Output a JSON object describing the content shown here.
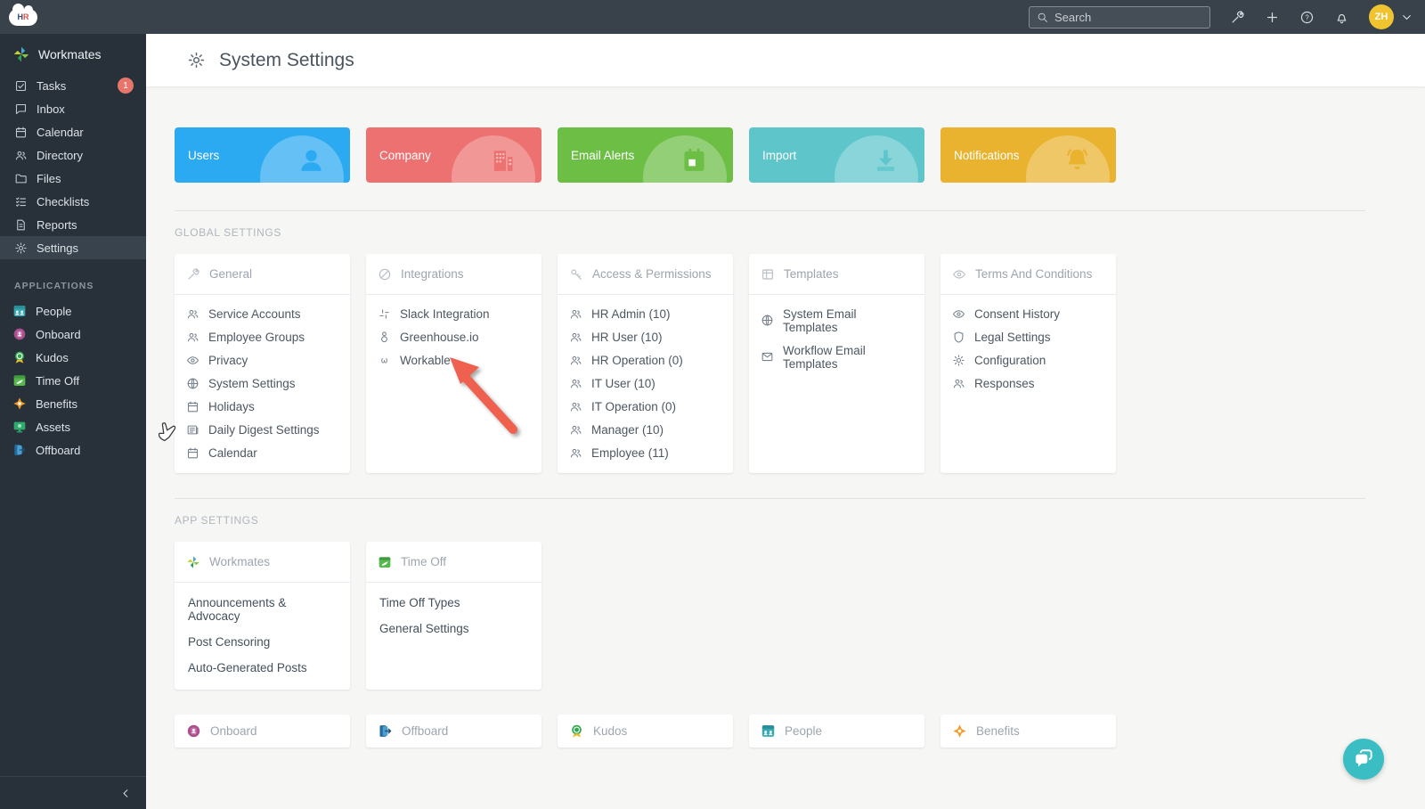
{
  "topbar": {
    "logo_h": "H",
    "logo_r": "R",
    "search_placeholder": "Search",
    "icons": [
      "wrench-icon",
      "plus-icon",
      "help-icon",
      "bell-icon"
    ],
    "avatar_initials": "ZH"
  },
  "sidebar": {
    "brand": "Workmates",
    "items": [
      {
        "label": "Tasks",
        "icon": "check-square-icon",
        "badge": "1"
      },
      {
        "label": "Inbox",
        "icon": "chat-icon"
      },
      {
        "label": "Calendar",
        "icon": "calendar-icon"
      },
      {
        "label": "Directory",
        "icon": "people-icon"
      },
      {
        "label": "Files",
        "icon": "folder-icon"
      },
      {
        "label": "Checklists",
        "icon": "checklist-icon"
      },
      {
        "label": "Reports",
        "icon": "document-icon"
      },
      {
        "label": "Settings",
        "icon": "gear-icon",
        "active": true
      }
    ],
    "applications_label": "APPLICATIONS",
    "applications": [
      {
        "label": "People",
        "icon": "app-people-icon"
      },
      {
        "label": "Onboard",
        "icon": "app-onboard-icon"
      },
      {
        "label": "Kudos",
        "icon": "app-kudos-icon"
      },
      {
        "label": "Time Off",
        "icon": "app-timeoff-icon"
      },
      {
        "label": "Benefits",
        "icon": "app-benefits-icon"
      },
      {
        "label": "Assets",
        "icon": "app-assets-icon"
      },
      {
        "label": "Offboard",
        "icon": "app-offboard-icon"
      }
    ]
  },
  "header": {
    "title": "System Settings",
    "icon": "gear-icon"
  },
  "cards": [
    {
      "label": "Users",
      "color": "#2BA9F1",
      "icon": "user-filled-icon"
    },
    {
      "label": "Company",
      "color": "#EC7170",
      "icon": "building-filled-icon"
    },
    {
      "label": "Email Alerts",
      "color": "#6CBE45",
      "icon": "calendar-filled-icon"
    },
    {
      "label": "Import",
      "color": "#5EC6CB",
      "icon": "download-filled-icon"
    },
    {
      "label": "Notifications",
      "color": "#E9B32F",
      "icon": "bell-filled-icon"
    }
  ],
  "global_settings": {
    "label": "GLOBAL SETTINGS",
    "columns": [
      {
        "title": "General",
        "icon": "wrench-icon",
        "items": [
          {
            "label": "Service Accounts",
            "icon": "people-icon"
          },
          {
            "label": "Employee Groups",
            "icon": "people-icon"
          },
          {
            "label": "Privacy",
            "icon": "eye-icon"
          },
          {
            "label": "System Settings",
            "icon": "globe-icon"
          },
          {
            "label": "Holidays",
            "icon": "calendar-icon"
          },
          {
            "label": "Daily Digest Settings",
            "icon": "newspaper-icon"
          },
          {
            "label": "Calendar",
            "icon": "calendar-icon"
          }
        ]
      },
      {
        "title": "Integrations",
        "icon": "link-icon",
        "items": [
          {
            "label": "Slack Integration",
            "icon": "slack-icon"
          },
          {
            "label": "Greenhouse.io",
            "icon": "greenhouse-icon"
          },
          {
            "label": "Workable",
            "icon": "workable-icon"
          }
        ]
      },
      {
        "title": "Access & Permissions",
        "icon": "key-icon",
        "items": [
          {
            "label": "HR Admin (10)",
            "icon": "people-icon"
          },
          {
            "label": "HR User (10)",
            "icon": "people-icon"
          },
          {
            "label": "HR Operation (0)",
            "icon": "people-icon"
          },
          {
            "label": "IT User (10)",
            "icon": "people-icon"
          },
          {
            "label": "IT Operation (0)",
            "icon": "people-icon"
          },
          {
            "label": "Manager (10)",
            "icon": "people-icon"
          },
          {
            "label": "Employee (11)",
            "icon": "people-icon"
          }
        ]
      },
      {
        "title": "Templates",
        "icon": "table-icon",
        "items": [
          {
            "label": "System Email Templates",
            "icon": "globe-icon"
          },
          {
            "label": "Workflow Email Templates",
            "icon": "envelope-icon"
          }
        ]
      },
      {
        "title": "Terms And Conditions",
        "icon": "eye-icon",
        "items": [
          {
            "label": "Consent History",
            "icon": "eye-icon"
          },
          {
            "label": "Legal Settings",
            "icon": "shield-icon"
          },
          {
            "label": "Configuration",
            "icon": "gear-icon"
          },
          {
            "label": "Responses",
            "icon": "people-icon"
          }
        ]
      }
    ]
  },
  "app_settings": {
    "label": "APP SETTINGS",
    "cards": [
      {
        "title": "Workmates",
        "icon": "workmates-logo-icon",
        "items": [
          "Announcements & Advocacy",
          "Post Censoring",
          "Auto-Generated Posts"
        ]
      },
      {
        "title": "Time Off",
        "icon": "app-timeoff-icon",
        "items": [
          "Time Off Types",
          "General Settings"
        ]
      }
    ]
  },
  "app_links": [
    {
      "label": "Onboard",
      "icon": "app-onboard-icon"
    },
    {
      "label": "Offboard",
      "icon": "app-offboard-icon"
    },
    {
      "label": "Kudos",
      "icon": "app-kudos-icon"
    },
    {
      "label": "People",
      "icon": "app-people-icon"
    },
    {
      "label": "Benefits",
      "icon": "app-benefits-icon"
    }
  ],
  "accents": {
    "topbar_bg": "#39424B",
    "sidebar_bg": "#28303A",
    "sidebar_active": "#39434D",
    "badge_red": "#E8756B",
    "avatar_yellow": "#F0C431",
    "arrow_red": "#F0604E",
    "chat_teal": "#3BBEC3"
  }
}
